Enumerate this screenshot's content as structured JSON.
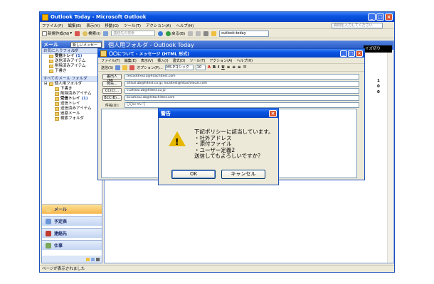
{
  "outlook": {
    "title": "Outlook Today - Microsoft Outlook",
    "menu": [
      "ファイル(F)",
      "編集(E)",
      "表示(V)",
      "移動(G)",
      "ツール(T)",
      "アクション(A)",
      "ヘルプ(H)"
    ],
    "help_placeholder": "質問を入力してください",
    "toolbar": {
      "new": "新規作成(N)",
      "find": "検索(I)",
      "contact_search": "連絡先の検索",
      "back": "戻る(B)",
      "address": "outlook:today"
    },
    "status": "ページが表示されました"
  },
  "nav": {
    "title": "メール",
    "new_message_tip": "新しいメッセージ",
    "favorites_title": "お気に入りフォルダ",
    "favorites": [
      {
        "name": "受信トレイ",
        "count": "(1)"
      },
      {
        "name": "送信済みアイテム",
        "count": ""
      },
      {
        "name": "削除済みアイテム",
        "count": ""
      },
      {
        "name": "下書き",
        "count": ""
      }
    ],
    "all_title": "すべてのメール フォルダ",
    "root": "個人用フォルダ",
    "folders": [
      {
        "name": "下書き",
        "count": ""
      },
      {
        "name": "削除済みアイテム",
        "count": ""
      },
      {
        "name": "受信トレイ",
        "count": "(1)"
      },
      {
        "name": "送信トレイ",
        "count": ""
      },
      {
        "name": "送信済みアイテム",
        "count": ""
      },
      {
        "name": "迷惑メール",
        "count": ""
      },
      {
        "name": "検索フォルダ",
        "count": ""
      }
    ],
    "buttons": {
      "mail": "メール",
      "calendar": "予定表",
      "contacts": "連絡先",
      "tasks": "仕事"
    }
  },
  "main": {
    "header": "個人用フォルダ - Outlook Today",
    "side_label": "イズ切り",
    "side_numbers": [
      "1",
      "0",
      "0"
    ]
  },
  "compose": {
    "title": "〇〇について - メッセージ (HTML 形式)",
    "menu": [
      "ファイル(F)",
      "編集(E)",
      "表示(V)",
      "挿入(I)",
      "書式(O)",
      "ツール(T)",
      "アクション(A)",
      "ヘルプ(H)"
    ],
    "send": "送信(S)",
    "options": "オプション(P)...",
    "font": "MS Pゴシック",
    "size": "10",
    "from_label": "差出人(M)...",
    "from_value": "testaddress1@hitachitest.com",
    "to_label": "宛先...",
    "to_value": "ahisai.ab@hitest.co.jp; localtest@hitachilocal.com",
    "cc_label": "CC(C)...",
    "cc_value": "ccahisai.ab@hitest.co.jp",
    "bcc_label": "BCC(B)...",
    "bcc_value": "bccahisai.ab@hitachitest.com",
    "subject_label": "件名(U):",
    "subject_value": "〇〇について"
  },
  "dialog": {
    "title": "警告",
    "message": "下記ポリシーに該当しています。\n・社外アドレス\n・添付ファイル\n・ユーザー定義2\n送信してもよろしいですか？",
    "ok": "OK",
    "cancel": "キャンセル"
  },
  "colors": {
    "titlebar": "#0a54e3",
    "close": "#d8532c",
    "nav_active": "#f6b54a",
    "warning": "#e6b800"
  }
}
